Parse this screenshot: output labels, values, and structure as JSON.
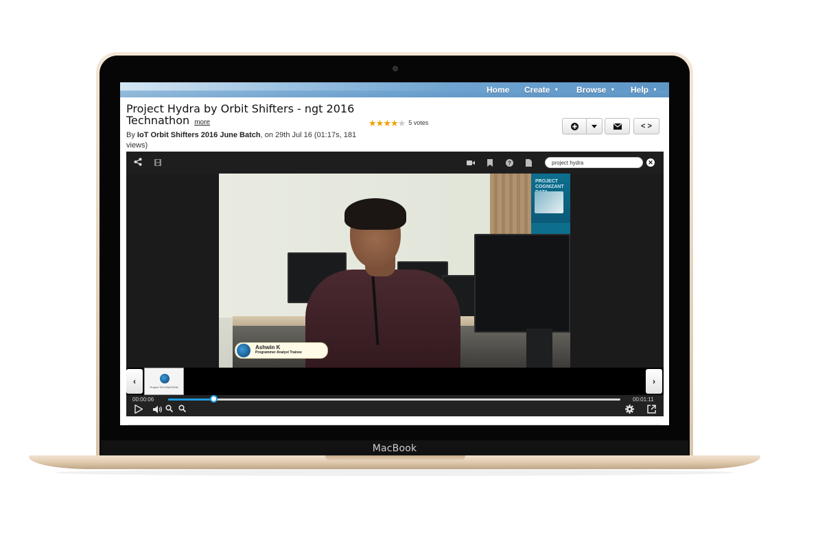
{
  "device": {
    "brand": "MacBook"
  },
  "nav": {
    "items": [
      {
        "label": "Home",
        "dropdown": false
      },
      {
        "label": "Create",
        "dropdown": true
      },
      {
        "label": "Browse",
        "dropdown": true
      },
      {
        "label": "Help",
        "dropdown": true
      }
    ]
  },
  "video": {
    "title": "Project Hydra by Orbit Shifters - ngt 2016 Technathon",
    "more_label": "more",
    "byline_prefix": "By ",
    "author": "IoT Orbit Shifters 2016 June Batch",
    "byline_suffix": ", on 29th Jul 16 (01:17s, 181 views)",
    "rating_stars": 4,
    "rating_max": 5,
    "votes_label": "5 votes"
  },
  "actions": {
    "add_icon": "plus-circle-icon",
    "caret_icon": "caret-down-icon",
    "email_icon": "envelope-icon",
    "embed_label": "< >"
  },
  "player": {
    "search_value": "project hydra",
    "lower_third": {
      "name": "Ashwin K",
      "role": "Programmer Analyst Trainee"
    },
    "poster_text": "PROJECT COGNIZANT DATA",
    "thumbnail_caption": "Project TECHNATHON",
    "current_time": "00:00:06",
    "duration": "00:01:11",
    "progress_fraction": 0.1
  },
  "colors": {
    "accent": "#1e9be0",
    "nav": "#5d95c6",
    "star": "#f2a100"
  }
}
